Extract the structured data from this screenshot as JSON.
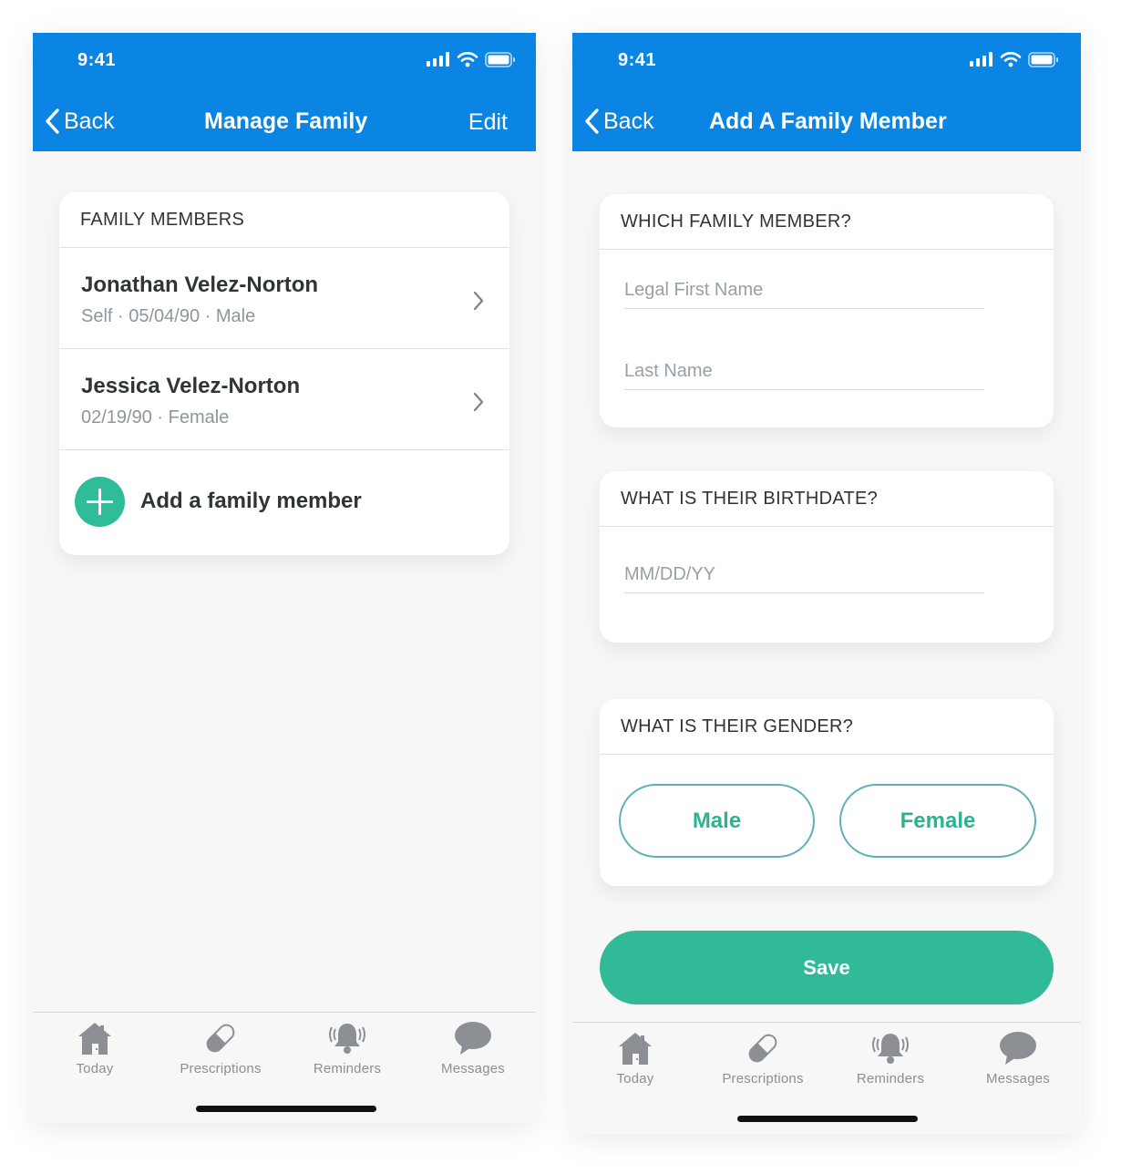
{
  "left": {
    "status": {
      "time": "9:41"
    },
    "nav": {
      "back": "Back",
      "title": "Manage Family",
      "edit": "Edit"
    },
    "card": {
      "header": "FAMILY MEMBERS",
      "members": [
        {
          "name": "Jonathan Velez-Norton",
          "details": "Self · 05/04/90 · Male"
        },
        {
          "name": "Jessica Velez-Norton",
          "details": "02/19/90 · Female"
        }
      ],
      "add_label": "Add a family member"
    }
  },
  "right": {
    "status": {
      "time": "9:41"
    },
    "nav": {
      "back": "Back",
      "title": "Add A Family Member"
    },
    "name_section": {
      "header": "WHICH FAMILY MEMBER?",
      "first_placeholder": "Legal First Name",
      "last_placeholder": "Last Name",
      "first_value": "",
      "last_value": ""
    },
    "birth_section": {
      "header": "WHAT IS THEIR BIRTHDATE?",
      "placeholder": "MM/DD/YY",
      "value": ""
    },
    "gender_section": {
      "header": "WHAT IS THEIR GENDER?",
      "male": "Male",
      "female": "Female"
    },
    "save": "Save"
  },
  "tabbar": {
    "items": [
      {
        "label": "Today",
        "icon": "home-icon"
      },
      {
        "label": "Prescriptions",
        "icon": "pill-icon"
      },
      {
        "label": "Reminders",
        "icon": "bell-icon"
      },
      {
        "label": "Messages",
        "icon": "chat-bubble-icon"
      }
    ]
  },
  "colors": {
    "nav_blue": "#0b85e3",
    "accent_green": "#31ba98",
    "outline_teal": "#5fb0b6",
    "tab_gray": "#8c8f93"
  }
}
